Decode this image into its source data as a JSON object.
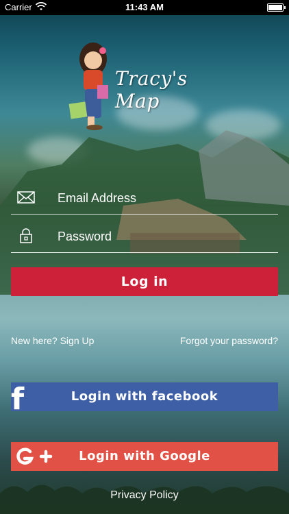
{
  "status_bar": {
    "carrier": "Carrier",
    "time": "11:43 AM"
  },
  "logo": {
    "text": "Tracy's Map"
  },
  "form": {
    "email_placeholder": "Email Address",
    "password_placeholder": "Password",
    "login_label": "Log in",
    "signup_link": "New here? Sign Up",
    "forgot_link": "Forgot your password?"
  },
  "social": {
    "facebook_label": "Login with facebook",
    "google_label": "Login with Google"
  },
  "footer": {
    "privacy_link": "Privacy Policy"
  },
  "colors": {
    "login_red": "#cc2138",
    "facebook_blue": "#3e5fa6",
    "google_red": "#e25145"
  }
}
